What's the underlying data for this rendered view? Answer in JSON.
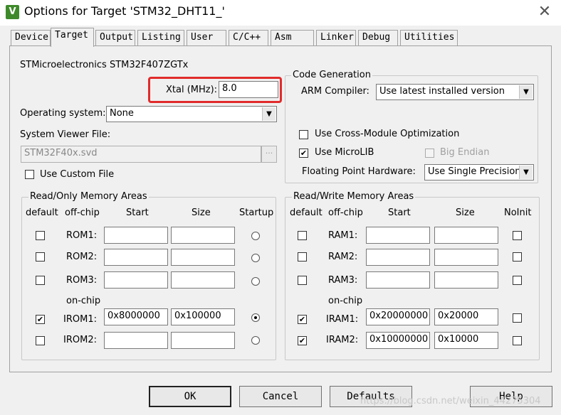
{
  "window": {
    "title": "Options for Target 'STM32_DHT11_'",
    "close_glyph": "✕",
    "icon_glyph": "V"
  },
  "tabs": [
    "Device",
    "Target",
    "Output",
    "Listing",
    "User",
    "C/C++",
    "Asm",
    "Linker",
    "Debug",
    "Utilities"
  ],
  "device_name": "STMicroelectronics STM32F407ZGTx",
  "xtal": {
    "label": "Xtal (MHz):",
    "value": "8.0"
  },
  "os": {
    "label": "Operating system:",
    "value": "None"
  },
  "svd": {
    "label": "System Viewer File:",
    "value": "STM32F40x.svd",
    "browse": "..."
  },
  "custom_file": {
    "label": "Use Custom File",
    "checked": false
  },
  "code_gen": {
    "title": "Code Generation",
    "compiler_label": "ARM Compiler:",
    "compiler_value": "Use latest installed version",
    "cross_module": {
      "label": "Use Cross-Module Optimization",
      "checked": false
    },
    "microlib": {
      "label": "Use MicroLIB",
      "checked": true
    },
    "big_endian": {
      "label": "Big Endian",
      "checked": false
    },
    "fp_label": "Floating Point Hardware:",
    "fp_value": "Use Single Precision"
  },
  "ro_memory": {
    "title": "Read/Only Memory Areas",
    "headers": {
      "default": "default",
      "offchip": "off-chip",
      "start": "Start",
      "size": "Size",
      "startup": "Startup"
    },
    "onchip_label": "on-chip",
    "rows": [
      {
        "name": "ROM1:",
        "start": "",
        "size": "",
        "default": false,
        "startup": false
      },
      {
        "name": "ROM2:",
        "start": "",
        "size": "",
        "default": false,
        "startup": false
      },
      {
        "name": "ROM3:",
        "start": "",
        "size": "",
        "default": false,
        "startup": false
      },
      {
        "name": "IROM1:",
        "start": "0x8000000",
        "size": "0x100000",
        "default": true,
        "startup": true
      },
      {
        "name": "IROM2:",
        "start": "",
        "size": "",
        "default": false,
        "startup": false
      }
    ]
  },
  "rw_memory": {
    "title": "Read/Write Memory Areas",
    "headers": {
      "default": "default",
      "offchip": "off-chip",
      "start": "Start",
      "size": "Size",
      "noinit": "NoInit"
    },
    "onchip_label": "on-chip",
    "rows": [
      {
        "name": "RAM1:",
        "start": "",
        "size": "",
        "default": false,
        "noinit": false
      },
      {
        "name": "RAM2:",
        "start": "",
        "size": "",
        "default": false,
        "noinit": false
      },
      {
        "name": "RAM3:",
        "start": "",
        "size": "",
        "default": false,
        "noinit": false
      },
      {
        "name": "IRAM1:",
        "start": "0x20000000",
        "size": "0x20000",
        "default": true,
        "noinit": false
      },
      {
        "name": "IRAM2:",
        "start": "0x10000000",
        "size": "0x10000",
        "default": true,
        "noinit": false
      }
    ]
  },
  "buttons": {
    "ok": "OK",
    "cancel": "Cancel",
    "defaults": "Defaults",
    "help": "Help"
  },
  "watermark": "https://blog.csdn.net/weixin_44275304",
  "colors": {
    "highlight_box": "#e12b2b",
    "app_icon": "#3e8a2a"
  }
}
